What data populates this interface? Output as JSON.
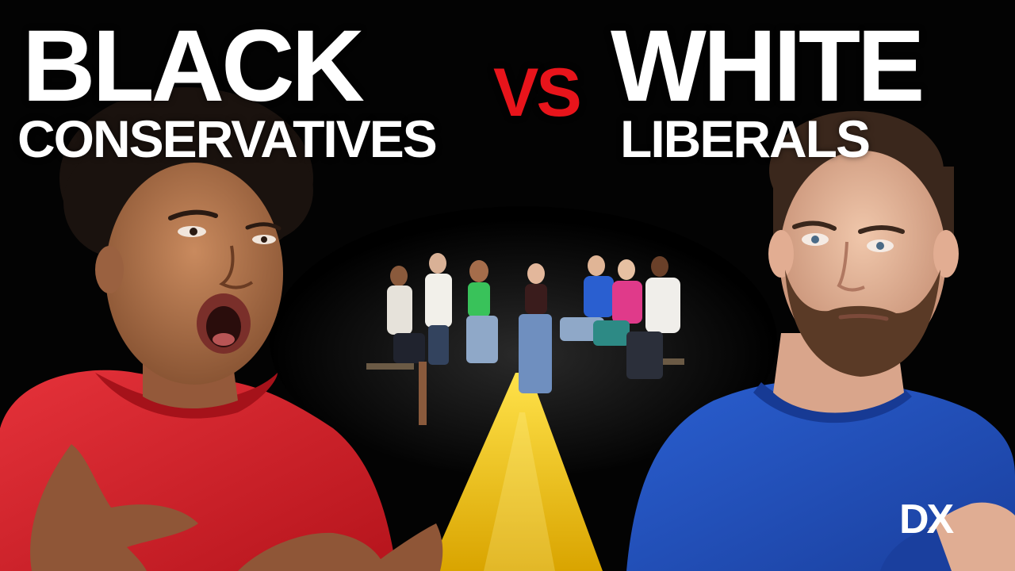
{
  "thumbnail": {
    "left_title": "BLACK",
    "left_subtitle": "CONSERVATIVES",
    "versus": "VS",
    "right_title": "WHITE",
    "right_subtitle": "LIBERALS",
    "shirt_logo": "DX"
  },
  "colors": {
    "background": "#030303",
    "title_text": "#ffffff",
    "versus": "#e8141b",
    "red_hoodie": "#d8222a",
    "blue_shirt": "#1f4fbd",
    "center_line": "#f2c81a"
  }
}
